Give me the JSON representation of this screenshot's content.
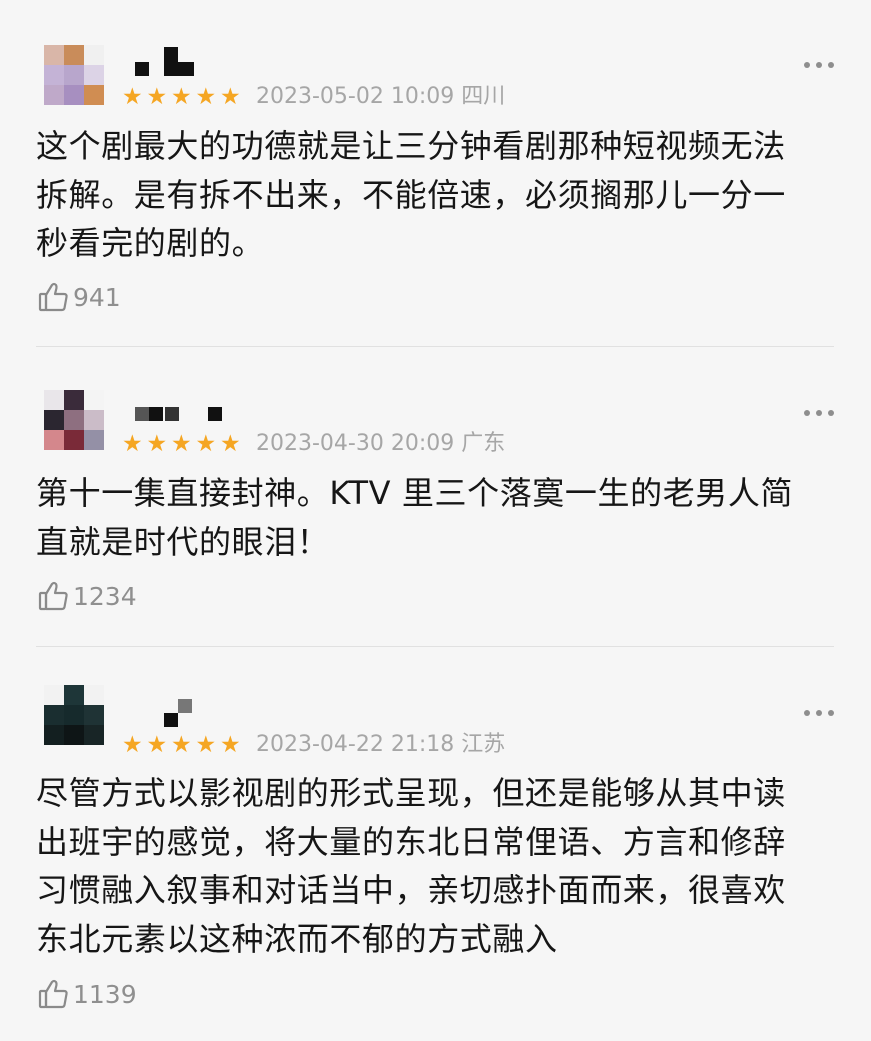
{
  "comments": [
    {
      "stars": "★★★★★",
      "rating": 5,
      "date": "2023-05-02 10:09 四川",
      "lines": [
        "这个剧最大的功德就是让三分钟看剧那种短视频无法",
        "拆解。是有拆不出来，不能倍速，必须搁那儿一分一",
        "秒看完的剧的。"
      ],
      "likes": "941",
      "more_icon": "more-dots-icon",
      "like_icon": "thumbs-up-icon"
    },
    {
      "stars": "★★★★★",
      "rating": 5,
      "date": "2023-04-30 20:09 广东",
      "lines": [
        "第十一集直接封神。KTV 里三个落寞一生的老男人简",
        "直就是时代的眼泪！"
      ],
      "likes": "1234",
      "more_icon": "more-dots-icon",
      "like_icon": "thumbs-up-icon"
    },
    {
      "stars": "★★★★★",
      "rating": 5,
      "date": "2023-04-22 21:18 江苏",
      "lines": [
        "尽管方式以影视剧的形式呈现，但还是能够从其中读",
        "出班宇的感觉，将大量的东北日常俚语、方言和修辞",
        "习惯融入叙事和对话当中，亲切感扑面而来，很喜欢",
        "东北元素以这种浓而不郁的方式融入"
      ],
      "likes": "1139",
      "more_icon": "more-dots-icon",
      "like_icon": "thumbs-up-icon"
    }
  ],
  "colors": {
    "star": "#f5a623",
    "date": "#a6a6a6",
    "likes": "#8f8f8f",
    "background": "#f6f6f6"
  }
}
